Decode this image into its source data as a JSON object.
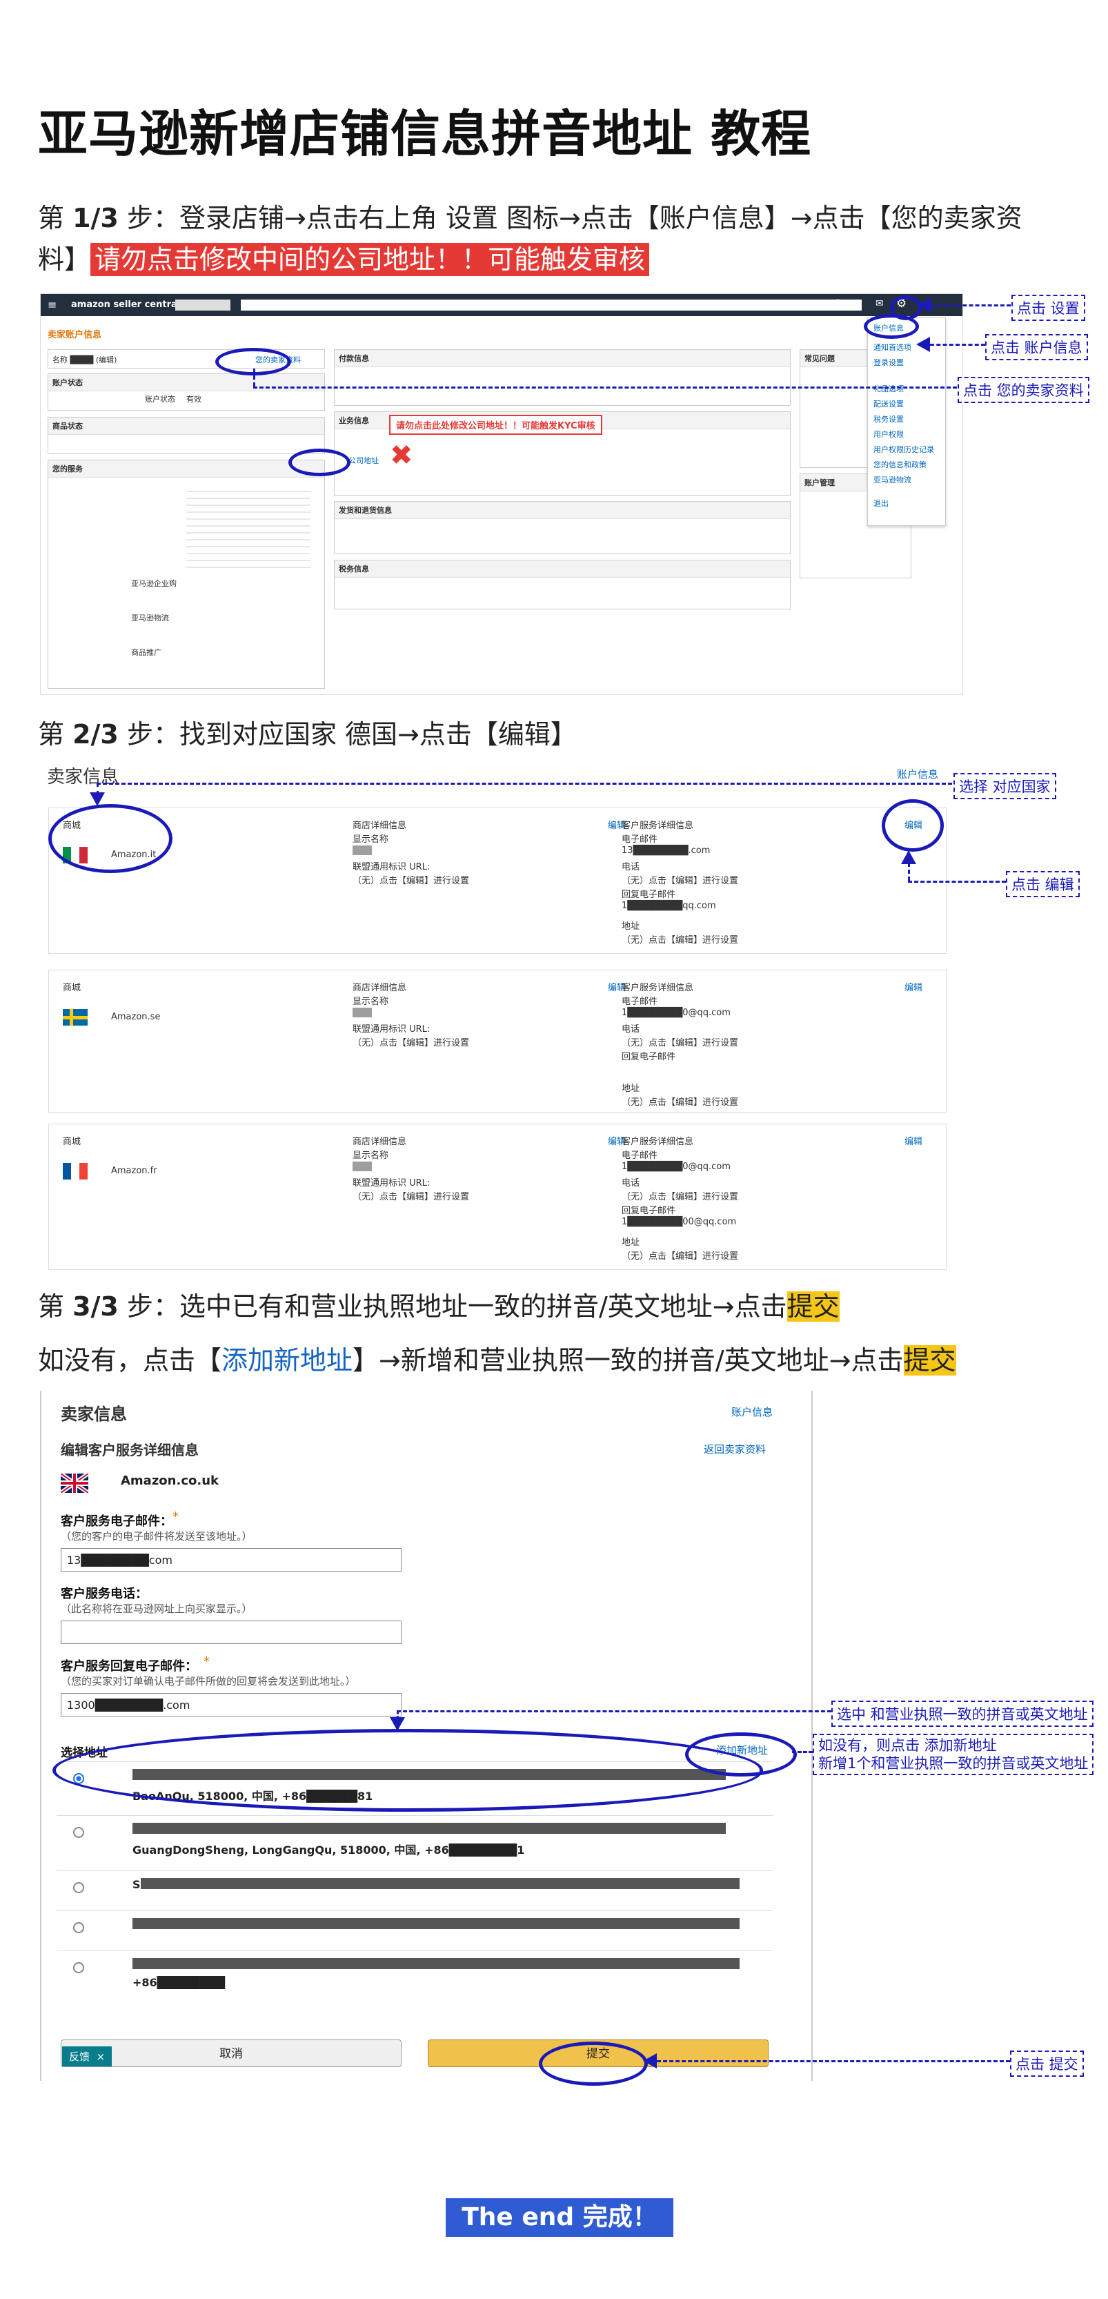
{
  "title": "亚马逊新增店铺信息拼音地址 教程",
  "step1": {
    "prefix": "第",
    "num": "1/3",
    "text": "步：登录店铺→点击右上角 设置 图标→点击【账户信息】→点击【您的卖家资",
    "text2": "料】",
    "warning": "请勿点击修改中间的公司地址！！可能触发审核"
  },
  "step2": {
    "prefix": "第",
    "num": "2/3",
    "text": "步：找到对应国家 德国→点击【编辑】"
  },
  "step3": {
    "prefix": "第",
    "num": "3/3",
    "text": "步：选中已有和营业执照地址一致的拼音/英文地址→点击",
    "submit": "提交",
    "line2_a": "如没有，点击【",
    "line2_link": "添加新地址",
    "line2_b": "】→新增和营业执照一致的拼音/英文地址→点击",
    "line2_submit": "提交"
  },
  "callouts": {
    "c1": "点击 设置",
    "c2": "点击 账户信息",
    "c3": "点击 您的卖家资料",
    "c4": "选择 对应国家",
    "c5": "点击 编辑",
    "c6": "选中 和营业执照一致的拼音或英文地址",
    "c7a": "如没有，则点击 添加新地址",
    "c7b": "新增1个和营业执照一致的拼音或英文地址",
    "c8": "点击 提交"
  },
  "shot1": {
    "brand": "amazon seller central",
    "page_heading": "卖家账户信息",
    "kyc_warning": "请勿点击此处修改公司地址！！可能触发KYC审核",
    "menu": [
      "账户信息",
      "通知首选项",
      "登录设置",
      "礼品选项",
      "配送设置",
      "税务设置",
      "用户权限",
      "用户权限历史记录",
      "您的信息和政策",
      "亚马逊物流",
      "退出"
    ],
    "panels": {
      "left": [
        "账户状态",
        "商品状态",
        "您的服务",
        "亚马逊企业购",
        "亚马逊物流",
        "商品推广"
      ],
      "mid": [
        "付款信息",
        "业务信息",
        "发货和退货信息",
        "税务信息"
      ],
      "right": [
        "常见问题",
        "账户管理"
      ]
    },
    "seller_profile_link": "您的卖家资料",
    "company_address_link": "公司地址",
    "status_label": "账户状态",
    "status_value": "有效"
  },
  "shot2": {
    "heading": "卖家信息",
    "account_link": "账户信息",
    "rows": [
      {
        "store_label": "商城",
        "store": "Amazon.it",
        "detail_h": "商店详细信息",
        "edit": "编辑",
        "svc_h": "客户服务详细信息",
        "svc_edit": "编辑",
        "display_name": "显示名称",
        "url_label": "联盟通用标识 URL:",
        "url_value": "（无）点击【编辑】进行设置",
        "email_label": "电子邮件",
        "email": "13████████.com",
        "phone_label": "电话",
        "phone": "（无）点击【编辑】进行设置",
        "reply_label": "回复电子邮件",
        "reply": "1████████qq.com",
        "addr_label": "地址",
        "addr": "（无）点击【编辑】进行设置",
        "flag": "it"
      },
      {
        "store_label": "商城",
        "store": "Amazon.se",
        "detail_h": "商店详细信息",
        "edit": "编辑",
        "svc_h": "客户服务详细信息",
        "svc_edit": "编辑",
        "display_name": "显示名称",
        "url_label": "联盟通用标识 URL:",
        "url_value": "（无）点击【编辑】进行设置",
        "email_label": "电子邮件",
        "email": "1████████0@qq.com",
        "phone_label": "电话",
        "phone": "（无）点击【编辑】进行设置",
        "reply_label": "回复电子邮件",
        "reply": "",
        "addr_label": "地址",
        "addr": "（无）点击【编辑】进行设置",
        "flag": "se"
      },
      {
        "store_label": "商城",
        "store": "Amazon.fr",
        "detail_h": "商店详细信息",
        "edit": "编辑",
        "svc_h": "客户服务详细信息",
        "svc_edit": "编辑",
        "display_name": "显示名称",
        "url_label": "联盟通用标识 URL:",
        "url_value": "（无）点击【编辑】进行设置",
        "email_label": "电子邮件",
        "email": "1████████0@qq.com",
        "phone_label": "电话",
        "phone": "（无）点击【编辑】进行设置",
        "reply_label": "回复电子邮件",
        "reply": "1████████00@qq.com",
        "addr_label": "地址",
        "addr": "（无）点击【编辑】进行设置",
        "flag": "fr"
      }
    ]
  },
  "shot3": {
    "heading": "卖家信息",
    "account_link": "账户信息",
    "subheading": "编辑客户服务详细信息",
    "back_link": "返回卖家资料",
    "store": "Amazon.co.uk",
    "email_label": "客户服务电子邮件：",
    "email_hint": "（您的客户的电子邮件将发送至该地址。）",
    "email_value": "13████████com",
    "phone_label": "客户服务电话：",
    "phone_hint": "（此名称将在亚马逊网址上向买家显示。）",
    "phone_value": "",
    "reply_label": "客户服务回复电子邮件：",
    "reply_hint": "（您的买家对订单确认电子邮件所做的回复将会发送到此地址。）",
    "reply_value": "1300████████.com",
    "select_label": "选择地址",
    "add_link": "添加新地址",
    "addresses": [
      "BaoAnQu, 518000, 中国, +86██████81",
      "GuangDongSheng, LongGangQu, 518000, 中国, +86████████1",
      "S",
      "",
      "+86████████"
    ],
    "cancel": "取消",
    "submit": "提交",
    "feedback": "反馈",
    "feedback_close": "×"
  },
  "the_end": "The end 完成！",
  "colors": {
    "accent_blue": "#1a1ab8",
    "warning_red": "#e53935",
    "highlight_yellow": "#f5c518",
    "amazon_dark": "#232f3e"
  }
}
